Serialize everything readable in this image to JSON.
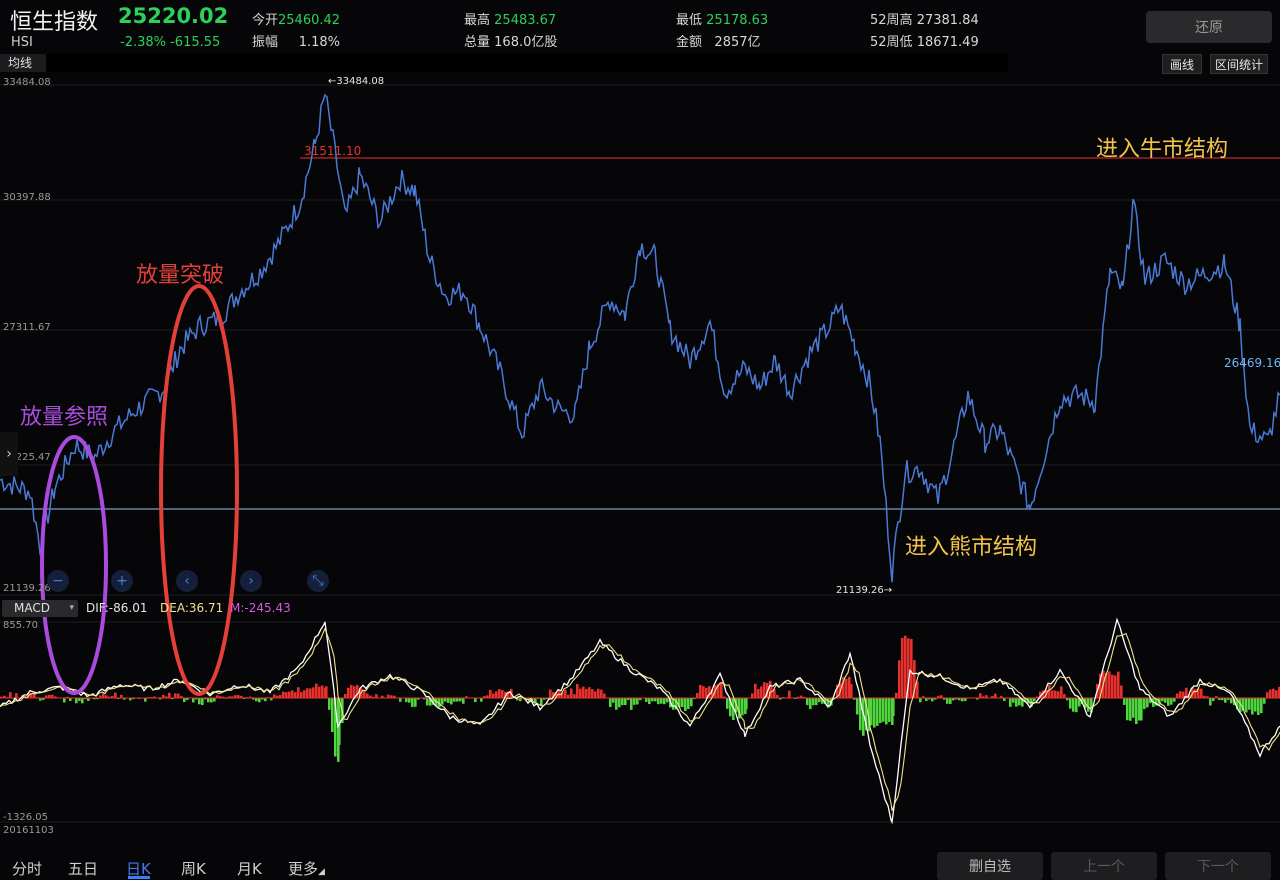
{
  "header": {
    "name": "恒生指数",
    "code": "HSI",
    "price": "25220.02",
    "change": "-2.38% -615.55",
    "open_label": "今开",
    "open_value": "25460.42",
    "amp_label": "振幅",
    "amp_value": "1.18%",
    "high_label": "最高",
    "high_value": "25483.67",
    "vol_label": "总量",
    "vol_value": "168.0亿股",
    "low_label": "最低",
    "low_value": "25178.63",
    "amt_label": "金额",
    "amt_value": "2857亿",
    "w52h_label": "52周高",
    "w52h_value": "27381.84",
    "w52l_label": "52周低",
    "w52l_value": "18671.49",
    "restore_label": "还原"
  },
  "toolbar": {
    "ma_label": "均线",
    "draw_label": "画线",
    "range_label": "区间统计"
  },
  "price_axis": [
    "33484.08",
    "30397.88",
    "27311.67",
    "24225.47",
    "21139.26"
  ],
  "markers": {
    "high": "←33484.08",
    "low": "21139.26→",
    "red_line": "31511.10",
    "last": "26469.16"
  },
  "annotations": {
    "bull": "进入牛市结构",
    "bear": "进入熊市结构",
    "breakout": "放量突破",
    "reference": "放量参照"
  },
  "macd": {
    "selector": "MACD",
    "dif": "DIF:-86.01",
    "dea": "DEA:36.71",
    "m": "M:-245.43",
    "top": "855.70",
    "bottom": "-1326.05",
    "date": "20161103"
  },
  "tabs": [
    "分时",
    "五日",
    "日K",
    "周K",
    "月K",
    "更多"
  ],
  "bottom_buttons": [
    "删自选",
    "上一个",
    "下一个"
  ],
  "colors": {
    "up": "#e8312d",
    "down": "#4fd63f",
    "line": "#4a79d6",
    "bull_text": "#f3c24a",
    "breakout": "#e4403a",
    "reference": "#a94cde",
    "accent": "#3f7cf0"
  },
  "chart_data": {
    "type": "line",
    "ylim": [
      21139.26,
      33484.08
    ],
    "price_path": [
      [
        0,
        23500
      ],
      [
        30,
        23200
      ],
      [
        40,
        21800
      ],
      [
        55,
        23300
      ],
      [
        75,
        24400
      ],
      [
        95,
        24100
      ],
      [
        115,
        24800
      ],
      [
        135,
        25300
      ],
      [
        150,
        25600
      ],
      [
        165,
        25900
      ],
      [
        180,
        26900
      ],
      [
        200,
        27500
      ],
      [
        220,
        27700
      ],
      [
        240,
        28400
      ],
      [
        260,
        28900
      ],
      [
        280,
        29700
      ],
      [
        300,
        30700
      ],
      [
        315,
        32200
      ],
      [
        325,
        33484.08
      ],
      [
        335,
        32000
      ],
      [
        345,
        30300
      ],
      [
        360,
        31400
      ],
      [
        380,
        30200
      ],
      [
        400,
        31300
      ],
      [
        415,
        31000
      ],
      [
        430,
        29200
      ],
      [
        445,
        28300
      ],
      [
        465,
        28400
      ],
      [
        480,
        27500
      ],
      [
        500,
        26300
      ],
      [
        522,
        24700
      ],
      [
        540,
        25900
      ],
      [
        560,
        25300
      ],
      [
        575,
        25200
      ],
      [
        590,
        27000
      ],
      [
        610,
        28200
      ],
      [
        625,
        27800
      ],
      [
        640,
        29600
      ],
      [
        655,
        29300
      ],
      [
        670,
        27400
      ],
      [
        690,
        26600
      ],
      [
        710,
        27600
      ],
      [
        725,
        25800
      ],
      [
        745,
        26400
      ],
      [
        760,
        25900
      ],
      [
        775,
        26600
      ],
      [
        790,
        25800
      ],
      [
        810,
        26800
      ],
      [
        830,
        27500
      ],
      [
        840,
        28000
      ],
      [
        855,
        27000
      ],
      [
        870,
        26000
      ],
      [
        880,
        24500
      ],
      [
        892,
        21139.26
      ],
      [
        905,
        23700
      ],
      [
        920,
        23800
      ],
      [
        938,
        23000
      ],
      [
        950,
        24000
      ],
      [
        968,
        25700
      ],
      [
        985,
        24500
      ],
      [
        1000,
        24800
      ],
      [
        1015,
        23800
      ],
      [
        1030,
        22800
      ],
      [
        1045,
        24200
      ],
      [
        1060,
        25600
      ],
      [
        1080,
        25700
      ],
      [
        1095,
        25500
      ],
      [
        1110,
        28900
      ],
      [
        1123,
        28400
      ],
      [
        1133,
        30700
      ],
      [
        1145,
        28700
      ],
      [
        1165,
        29200
      ],
      [
        1185,
        28600
      ],
      [
        1210,
        28900
      ],
      [
        1225,
        29100
      ],
      [
        1240,
        27500
      ],
      [
        1250,
        24800
      ],
      [
        1268,
        24500
      ],
      [
        1280,
        25700
      ]
    ],
    "macd_path": [
      [
        0,
        -100
      ],
      [
        30,
        60
      ],
      [
        60,
        120
      ],
      [
        90,
        20
      ],
      [
        120,
        150
      ],
      [
        150,
        100
      ],
      [
        180,
        200
      ],
      [
        210,
        40
      ],
      [
        240,
        150
      ],
      [
        270,
        60
      ],
      [
        300,
        350
      ],
      [
        325,
        855.7
      ],
      [
        338,
        -300
      ],
      [
        360,
        100
      ],
      [
        390,
        250
      ],
      [
        420,
        80
      ],
      [
        450,
        -200
      ],
      [
        480,
        -300
      ],
      [
        510,
        60
      ],
      [
        540,
        -100
      ],
      [
        570,
        200
      ],
      [
        600,
        620
      ],
      [
        630,
        320
      ],
      [
        660,
        100
      ],
      [
        690,
        -300
      ],
      [
        720,
        250
      ],
      [
        745,
        -400
      ],
      [
        770,
        120
      ],
      [
        800,
        200
      ],
      [
        830,
        -100
      ],
      [
        850,
        500
      ],
      [
        870,
        -500
      ],
      [
        892,
        -1326.05
      ],
      [
        910,
        300
      ],
      [
        940,
        240
      ],
      [
        970,
        100
      ],
      [
        1000,
        200
      ],
      [
        1030,
        -100
      ],
      [
        1060,
        300
      ],
      [
        1090,
        -200
      ],
      [
        1117,
        855.7
      ],
      [
        1140,
        100
      ],
      [
        1170,
        -200
      ],
      [
        1200,
        200
      ],
      [
        1230,
        50
      ],
      [
        1260,
        -600
      ],
      [
        1280,
        -300
      ]
    ],
    "reference_lines": {
      "upper": 31511.1,
      "lower": 22800
    }
  }
}
